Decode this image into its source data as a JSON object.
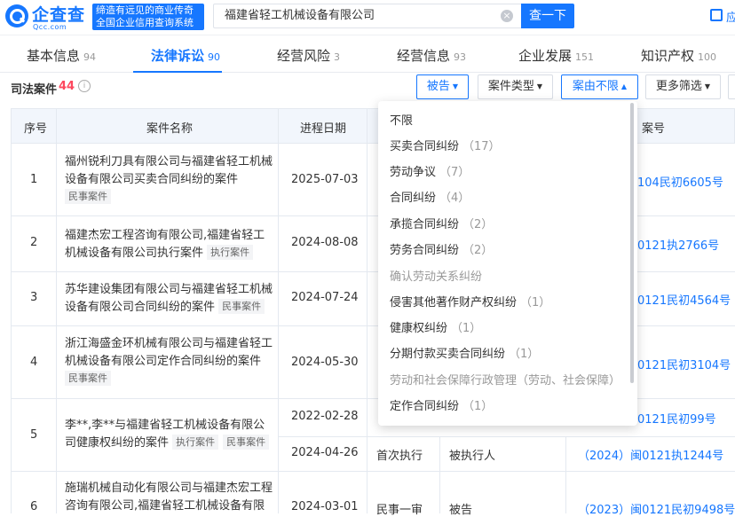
{
  "header": {
    "logo_text": "企查查",
    "logo_sub": "Qcc.com",
    "slogan_line1": "缔造有远见的商业传奇",
    "slogan_line2": "全国企业信用查询系统",
    "search_value": "福建省轻工机械设备有限公司",
    "clear_icon": "×",
    "search_button": "查一下",
    "app_label": "应"
  },
  "tabs": [
    {
      "label": "基本信息",
      "count": "94"
    },
    {
      "label": "法律诉讼",
      "count": "90"
    },
    {
      "label": "经营风险",
      "count": "3"
    },
    {
      "label": "经营信息",
      "count": "93"
    },
    {
      "label": "企业发展",
      "count": "151"
    },
    {
      "label": "知识产权",
      "count": "100"
    }
  ],
  "section": {
    "title": "司法案件",
    "count": "44",
    "info_icon": "i"
  },
  "filters": {
    "defendant": "被告",
    "case_type": "案件类型",
    "case_reason": "案由不限",
    "more": "更多筛选"
  },
  "table": {
    "headers": {
      "index": "序号",
      "name": "案件名称",
      "date": "进程日期",
      "case_no": "案号"
    },
    "rows": [
      {
        "index": "1",
        "name": "福州锐利刀具有限公司与福建省轻工机械设备有限公司买卖合同纠纷的案件",
        "tags": [
          "民事案件"
        ],
        "date": "2025-07-03",
        "case_no": "104民初6605号"
      },
      {
        "index": "2",
        "name": "福建杰宏工程咨询有限公司,福建省轻工机械设备有限公司执行案件",
        "tags": [
          "执行案件"
        ],
        "date": "2024-08-08",
        "case_no": "0121执2766号"
      },
      {
        "index": "3",
        "name": "苏华建设集团有限公司与福建省轻工机械设备有限公司合同纠纷的案件",
        "tags": [
          "民事案件"
        ],
        "date": "2024-07-24",
        "case_no": "0121民初4564号"
      },
      {
        "index": "4",
        "name": "浙江海盛金环机械有限公司与福建省轻工机械设备有限公司定作合同纠纷的案件",
        "tags": [
          "民事案件"
        ],
        "date": "2024-05-30",
        "case_no": "0121民初3104号"
      },
      {
        "index": "5",
        "name": "李**,李**与福建省轻工机械设备有限公司健康权纠纷的案件",
        "tags": [
          "执行案件",
          "民事案件"
        ],
        "date": "2022-02-28",
        "case_no": "0121民初99号",
        "sub": {
          "date": "2024-04-26",
          "stage": "首次执行",
          "role": "被执行人",
          "case_no": "（2024）闽0121执1244号"
        }
      },
      {
        "index": "6",
        "name": "施瑞机械自动化有限公司与福建杰宏工程咨询有限公司,福建省轻工机械设备有限",
        "tags": [],
        "date": "2024-03-01",
        "stage": "民事一审",
        "role": "被告",
        "case_no": "（2023）闽0121民初9498号"
      }
    ]
  },
  "dropdown": {
    "items": [
      {
        "label": "不限",
        "count": ""
      },
      {
        "label": "买卖合同纠纷",
        "count": "（17）"
      },
      {
        "label": "劳动争议",
        "count": "（7）"
      },
      {
        "label": "合同纠纷",
        "count": "（4）"
      },
      {
        "label": "承揽合同纠纷",
        "count": "（2）"
      },
      {
        "label": "劳务合同纠纷",
        "count": "（2）"
      },
      {
        "label": "确认劳动关系纠纷",
        "count": ""
      },
      {
        "label": "侵害其他著作财产权纠纷",
        "count": "（1）"
      },
      {
        "label": "健康权纠纷",
        "count": "（1）"
      },
      {
        "label": "分期付款买卖合同纠纷",
        "count": "（1）"
      },
      {
        "label": "劳动和社会保障行政管理（劳动、社会保障）",
        "count": ""
      },
      {
        "label": "定作合同纠纷",
        "count": "（1）"
      }
    ]
  },
  "colors": {
    "accent": "#1677ff",
    "count_red": "#fd485e"
  }
}
